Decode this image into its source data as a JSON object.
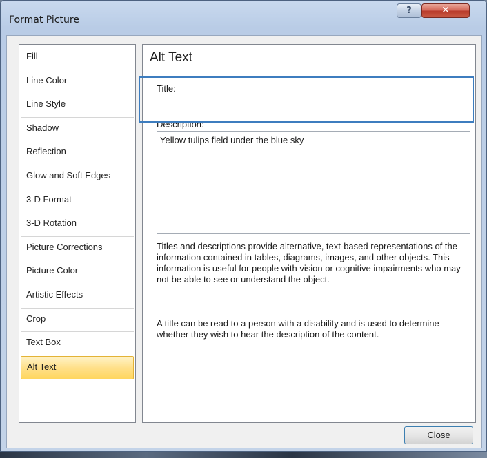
{
  "window": {
    "title": "Format Picture",
    "help_glyph": "?",
    "close_glyph": "✕"
  },
  "sidebar": {
    "items": [
      {
        "label": "Fill",
        "selected": false
      },
      {
        "label": "Line Color",
        "selected": false
      },
      {
        "label": "Line Style",
        "selected": false
      },
      {
        "label": "Shadow",
        "selected": false
      },
      {
        "label": "Reflection",
        "selected": false
      },
      {
        "label": "Glow and Soft Edges",
        "selected": false
      },
      {
        "label": "3-D Format",
        "selected": false
      },
      {
        "label": "3-D Rotation",
        "selected": false
      },
      {
        "label": "Picture Corrections",
        "selected": false
      },
      {
        "label": "Picture Color",
        "selected": false
      },
      {
        "label": "Artistic Effects",
        "selected": false
      },
      {
        "label": "Crop",
        "selected": false
      },
      {
        "label": "Text Box",
        "selected": false
      },
      {
        "label": "Alt Text",
        "selected": true
      }
    ]
  },
  "panel": {
    "heading": "Alt Text",
    "title_label": "Title:",
    "title_value": "",
    "description_label": "Description:",
    "description_value": "Yellow tulips field under the blue sky",
    "help_paragraph_1": "Titles and descriptions provide alternative, text-based representations of the information contained in tables, diagrams, images, and other objects. This information is useful for people with vision or cognitive impairments who may not be able to see or understand the object.",
    "help_paragraph_2": "A title can be read to a person with a disability and is used to determine whether they wish to hear the description of the content."
  },
  "footer": {
    "close_label": "Close"
  },
  "colors": {
    "selection_fill": "#ffd65e",
    "highlight_box": "#3d7dbf",
    "close_button_red": "#c85a44"
  }
}
